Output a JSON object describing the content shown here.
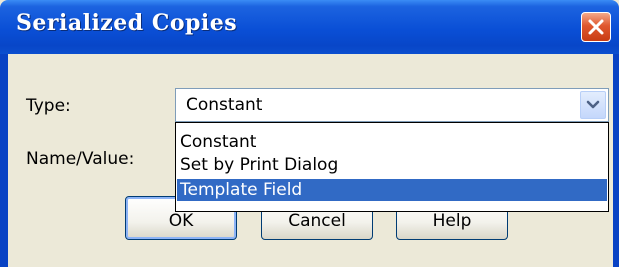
{
  "window": {
    "title": "Serialized Copies"
  },
  "labels": {
    "type": "Type:",
    "name_value": "Name/Value:"
  },
  "type_select": {
    "value": "Constant",
    "options": [
      "Constant",
      "Set by Print Dialog",
      "Template Field"
    ],
    "highlighted": "Template Field"
  },
  "buttons": {
    "ok": "OK",
    "cancel": "Cancel",
    "help": "Help"
  },
  "colors": {
    "titlebar": "#0a4fd6",
    "selection": "#316ac5",
    "dialog_bg": "#ece9d8",
    "close_button": "#e0582f"
  },
  "icons": {
    "close": "close-icon",
    "dropdown": "chevron-down-icon"
  }
}
